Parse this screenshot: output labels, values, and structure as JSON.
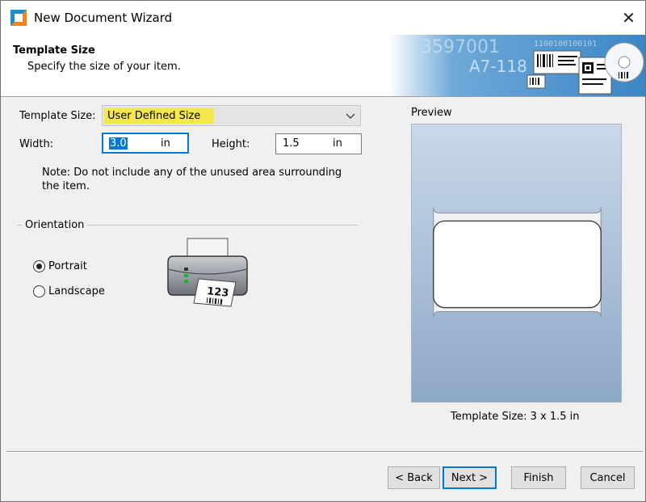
{
  "window": {
    "title": "New Document Wizard",
    "close_glyph": "✕"
  },
  "header": {
    "title": "Template Size",
    "subtitle": "Specify the size of your item."
  },
  "form": {
    "template_size_label": "Template Size:",
    "template_size_value": "User Defined Size",
    "width_label": "Width:",
    "width_value": "3.0",
    "width_unit": "in",
    "height_label": "Height:",
    "height_value": "1.5",
    "height_unit": "in",
    "note": "Note: Do not include any of the unused area surrounding the item."
  },
  "orientation": {
    "group_label": "Orientation",
    "options": [
      {
        "label": "Portrait",
        "selected": true
      },
      {
        "label": "Landscape",
        "selected": false
      }
    ]
  },
  "preview": {
    "label": "Preview",
    "template_size_text": "Template Size:  3 x 1.5 in"
  },
  "buttons": {
    "back": "< Back",
    "next": "Next >",
    "finish": "Finish",
    "cancel": "Cancel"
  },
  "banner": {
    "text_1": "3597001",
    "text_2": "A7-118",
    "text_3": "1100100100101"
  },
  "printer_label_text": "123",
  "colors": {
    "accent": "#0078d7",
    "highlight": "#f6e84a"
  },
  "icons": {
    "app": "wizard-app-icon",
    "close": "close-icon",
    "dropdown": "chevron-down-icon",
    "printer": "printer-icon"
  }
}
